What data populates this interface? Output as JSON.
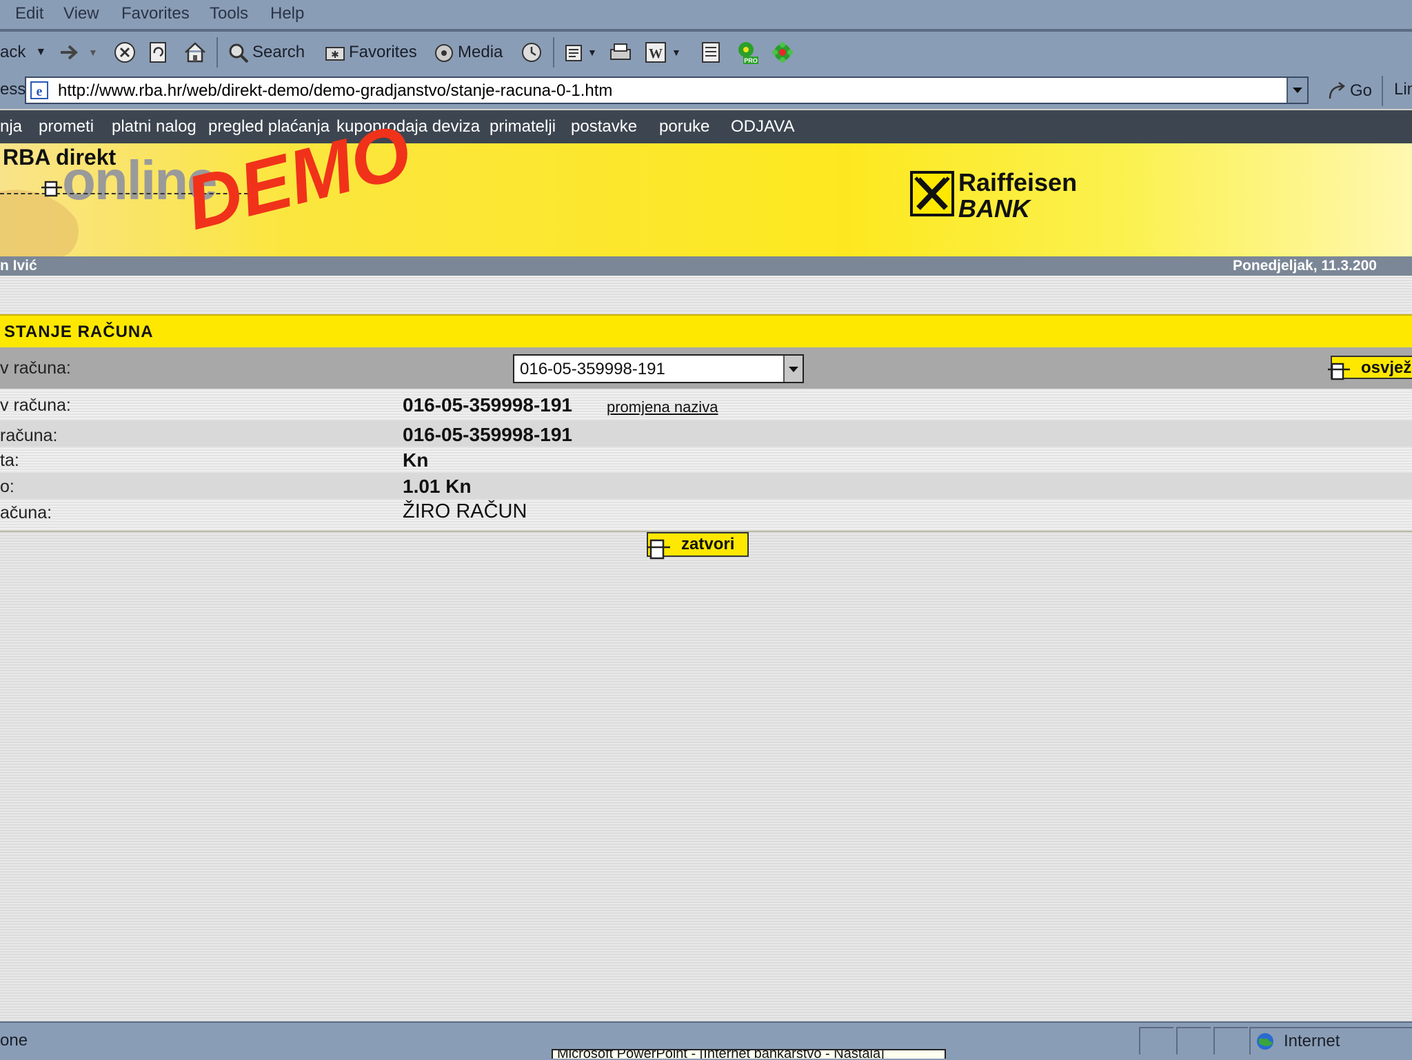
{
  "menubar": {
    "items": [
      "Edit",
      "View",
      "Favorites",
      "Tools",
      "Help"
    ]
  },
  "toolbar": {
    "back_label": "ack",
    "search_label": "Search",
    "favorites_label": "Favorites",
    "media_label": "Media"
  },
  "addressbar": {
    "label": "ess",
    "url": "http://www.rba.hr/web/direkt-demo/demo-gradjanstvo/stanje-racuna-0-1.htm",
    "go_label": "Go",
    "links_label": "Lin"
  },
  "nav": {
    "items": [
      "nja",
      "prometi",
      "platni nalog",
      "pregled plaćanja",
      "kupoprodaja deviza",
      "primatelji",
      "postavke",
      "poruke",
      "ODJAVA"
    ]
  },
  "banner": {
    "brand_line": "RBA direkt",
    "online_word": "online",
    "demo_word": "DEMO",
    "bank_name_1": "Raiffeisen",
    "bank_name_2": "BANK"
  },
  "userbar": {
    "user": "n Ivić",
    "date": "Ponedjeljak, 11.3.200"
  },
  "page": {
    "title": "STANJE RAČUNA",
    "select_label": "v računa:",
    "selected_account": "016-05-359998-191",
    "refresh_label": "osvjež",
    "rows": [
      {
        "label": "v računa:",
        "value": "016-05-359998-191"
      },
      {
        "label": "računa:",
        "value": "016-05-359998-191"
      },
      {
        "label": "ta:",
        "value": "Kn"
      },
      {
        "label": "o:",
        "value": "1.01 Kn"
      },
      {
        "label": "ačuna:",
        "value": "ŽIRO RAČUN"
      }
    ],
    "rename_link": "promjena naziva",
    "close_label": "zatvori"
  },
  "statusbar": {
    "left_text": "one",
    "zone": "Internet",
    "tooltip": "Microsoft PowerPoint - [Internet bankarstvo - Nastala]"
  },
  "colors": {
    "chrome": "#8a9db6",
    "nav": "#3d4650",
    "brand_yellow": "#fee800",
    "demo_red": "#f0321a"
  }
}
